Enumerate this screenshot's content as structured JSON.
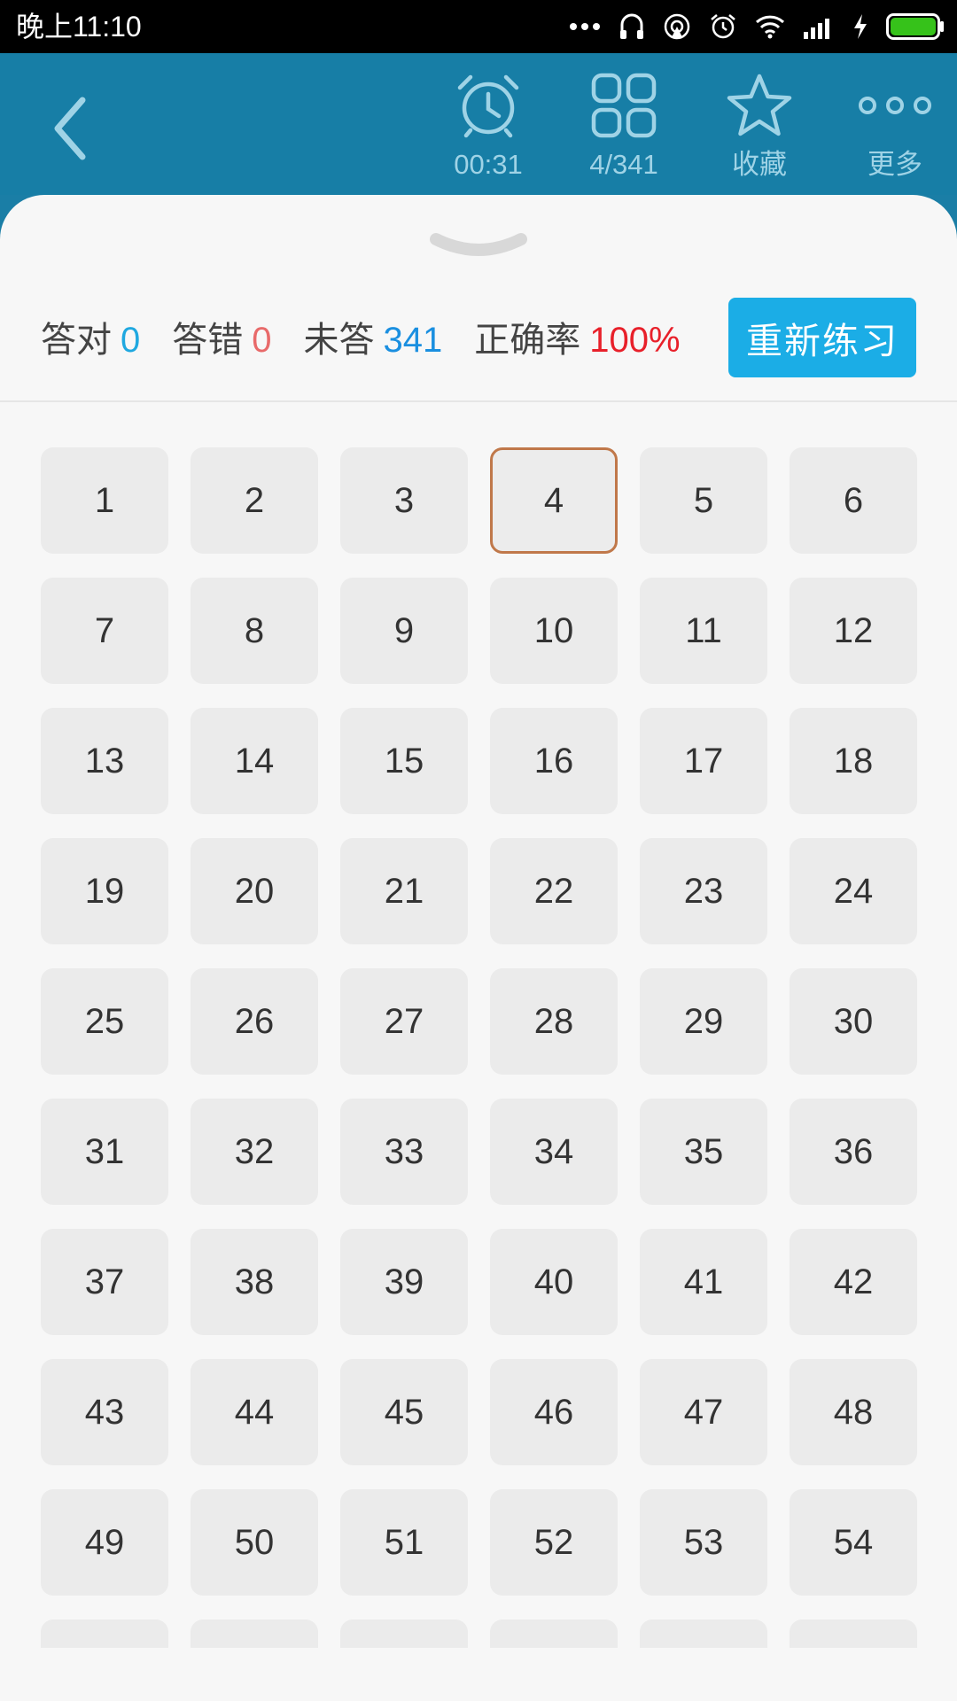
{
  "status_bar": {
    "time": "晚上11:10",
    "icons": [
      "more-dots-icon",
      "headphone-icon",
      "hotspot-icon",
      "alarm-icon",
      "wifi-icon",
      "signal-icon",
      "charging-icon",
      "battery-icon"
    ]
  },
  "header": {
    "back_icon": "chevron-left-icon",
    "timer": "00:31",
    "progress": "4/341",
    "favorite": "收藏",
    "more": "更多"
  },
  "stats": {
    "correct_label": "答对",
    "correct_value": "0",
    "wrong_label": "答错",
    "wrong_value": "0",
    "unanswered_label": "未答",
    "unanswered_value": "341",
    "accuracy_label": "正确率",
    "accuracy_value": "100%"
  },
  "restart_label": "重新练习",
  "current_question": "4",
  "questions": [
    "1",
    "2",
    "3",
    "4",
    "5",
    "6",
    "7",
    "8",
    "9",
    "10",
    "11",
    "12",
    "13",
    "14",
    "15",
    "16",
    "17",
    "18",
    "19",
    "20",
    "21",
    "22",
    "23",
    "24",
    "25",
    "26",
    "27",
    "28",
    "29",
    "30",
    "31",
    "32",
    "33",
    "34",
    "35",
    "36",
    "37",
    "38",
    "39",
    "40",
    "41",
    "42",
    "43",
    "44",
    "45",
    "46",
    "47",
    "48",
    "49",
    "50",
    "51",
    "52",
    "53",
    "54",
    "",
    "",
    "",
    "",
    "",
    ""
  ],
  "colors": {
    "header_bg": "#177ea6",
    "correct": "#1fa8e0",
    "wrong": "#e86a6a",
    "unanswered": "#1a8fe0",
    "accuracy": "#e8202a",
    "button": "#1bade6",
    "current_border": "#c0784a"
  }
}
